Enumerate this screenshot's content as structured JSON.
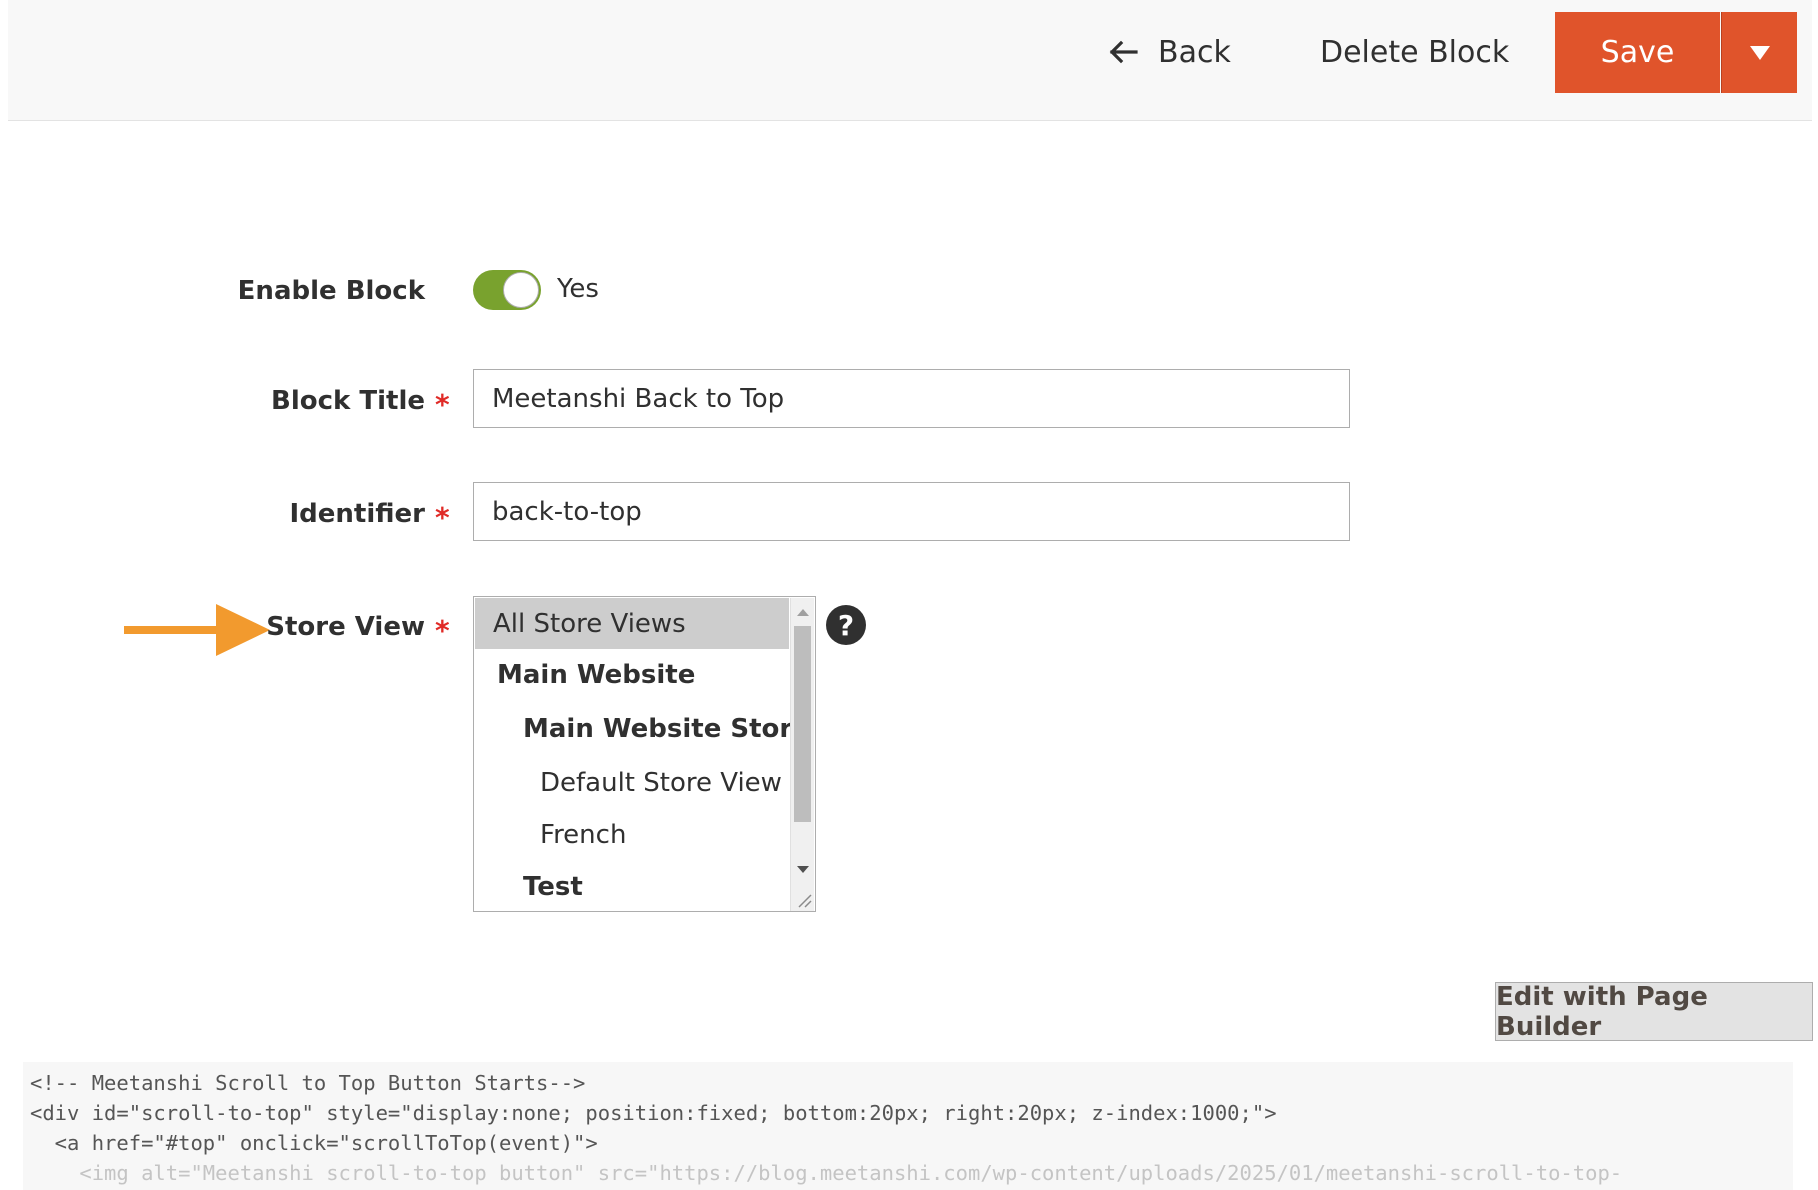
{
  "header": {
    "back_label": "Back",
    "delete_label": "Delete Block",
    "save_label": "Save",
    "accent_color": "#e0542b"
  },
  "form": {
    "enable_block": {
      "label": "Enable Block",
      "value": "Yes",
      "checked": true
    },
    "block_title": {
      "label": "Block Title",
      "value": "Meetanshi Back to Top"
    },
    "identifier": {
      "label": "Identifier",
      "value": "back-to-top"
    },
    "store_view": {
      "label": "Store View",
      "options": [
        {
          "label": "All Store Views",
          "level": 0,
          "selected": true,
          "group": false
        },
        {
          "label": "Main Website",
          "level": 1,
          "selected": false,
          "group": true
        },
        {
          "label": "Main Website Store",
          "level": 2,
          "selected": false,
          "group": true
        },
        {
          "label": "Default Store View",
          "level": 3,
          "selected": false,
          "group": false
        },
        {
          "label": "French",
          "level": 3,
          "selected": false,
          "group": false
        },
        {
          "label": "Test",
          "level": 2,
          "selected": false,
          "group": true
        }
      ]
    },
    "required_mark": "*",
    "help_symbol": "?"
  },
  "content": {
    "page_builder_label": "Edit with Page Builder",
    "code_lines": [
      "<!-- Meetanshi Scroll to Top Button Starts-->",
      "<div id=\"scroll-to-top\" style=\"display:none; position:fixed; bottom:20px; right:20px; z-index:1000;\">",
      "  <a href=\"#top\" onclick=\"scrollToTop(event)\">",
      "    <img alt=\"Meetanshi scroll-to-top button\" src=\"https://blog.meetanshi.com/wp-content/uploads/2025/01/meetanshi-scroll-to-top-"
    ]
  },
  "icons": {
    "back": "arrow-left-icon",
    "save_menu": "triangle-down-icon",
    "help": "question-circle-icon",
    "annotation": "arrow-right-icon"
  }
}
